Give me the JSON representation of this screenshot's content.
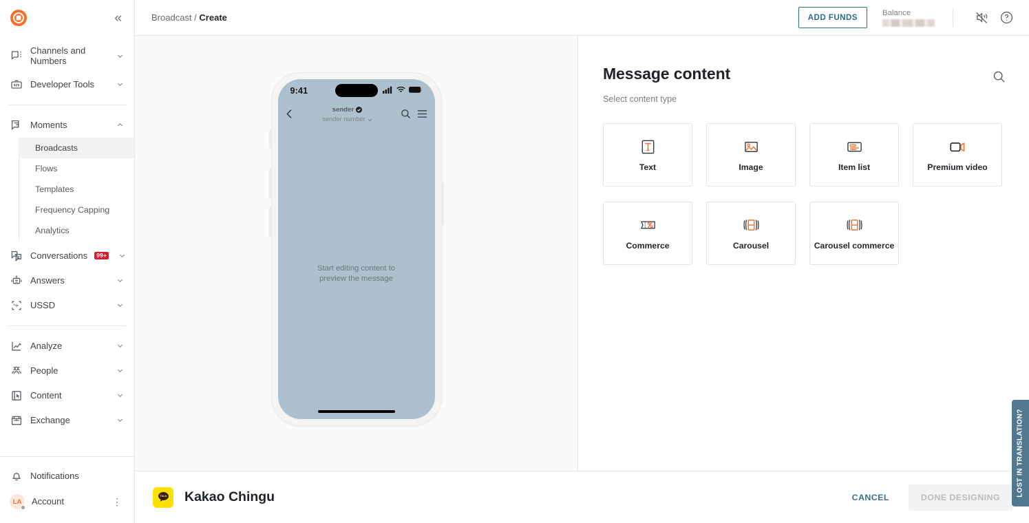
{
  "sidebar": {
    "brand_icon": "bullseye-logo-icon",
    "collapse_icon": "chevron-double-left-icon",
    "groups": [
      {
        "items": [
          {
            "label": "Channels and Numbers",
            "icon": "chat-dots-icon",
            "chevron": "chevron-down-icon"
          },
          {
            "label": "Developer Tools",
            "icon": "code-toolbox-icon",
            "chevron": "chevron-down-icon"
          }
        ]
      },
      {
        "items": [
          {
            "label": "Moments",
            "icon": "moments-layers-icon",
            "chevron": "chevron-up-icon",
            "expanded": true
          }
        ],
        "submenu": [
          {
            "label": "Broadcasts",
            "active": true
          },
          {
            "label": "Flows",
            "active": false
          },
          {
            "label": "Templates",
            "active": false
          },
          {
            "label": "Frequency Capping",
            "active": false
          },
          {
            "label": "Analytics",
            "active": false
          }
        ]
      },
      {
        "items": [
          {
            "label": "Conversations",
            "icon": "conversations-icon",
            "badge": "99+",
            "chevron": "chevron-down-icon"
          },
          {
            "label": "Answers",
            "icon": "robot-icon",
            "chevron": "chevron-down-icon"
          },
          {
            "label": "USSD",
            "icon": "ussd-star-hash-icon",
            "chevron": "chevron-down-icon"
          }
        ]
      },
      {
        "items": [
          {
            "label": "Analyze",
            "icon": "line-chart-icon",
            "chevron": "chevron-down-icon"
          },
          {
            "label": "People",
            "icon": "people-icon",
            "chevron": "chevron-down-icon"
          },
          {
            "label": "Content",
            "icon": "content-cursor-icon",
            "chevron": "chevron-down-icon"
          },
          {
            "label": "Exchange",
            "icon": "storefront-icon",
            "chevron": "chevron-down-icon"
          }
        ]
      }
    ],
    "bottom": {
      "notifications_label": "Notifications",
      "notifications_icon": "bell-icon",
      "account_label": "Account",
      "account_initials": "LA",
      "account_menu_icon": "kebab-menu-icon"
    }
  },
  "topbar": {
    "breadcrumb_parent": "Broadcast",
    "breadcrumb_separator": "/",
    "breadcrumb_current": "Create",
    "add_funds_label": "ADD FUNDS",
    "balance_label": "Balance",
    "balance_value": "",
    "mute_icon": "speaker-muted-icon",
    "help_icon": "help-circle-icon"
  },
  "preview": {
    "status_time": "9:41",
    "signal_icon": "cellular-signal-icon",
    "wifi_icon": "wifi-icon",
    "battery_icon": "battery-icon",
    "back_icon": "chevron-left-icon",
    "sender_name": "sender",
    "verified_icon": "verified-badge-icon",
    "sender_number": "sender number",
    "sender_dropdown_icon": "caret-down-icon",
    "search_icon": "search-icon",
    "menu_icon": "hamburger-menu-icon",
    "placeholder_line1": "Start editing content to",
    "placeholder_line2": "preview the message"
  },
  "content": {
    "title": "Message content",
    "search_icon": "search-icon",
    "subtitle": "Select content type",
    "types": [
      {
        "label": "Text",
        "icon": "text-type-icon"
      },
      {
        "label": "Image",
        "icon": "image-type-icon"
      },
      {
        "label": "Item list",
        "icon": "item-list-type-icon"
      },
      {
        "label": "Premium video",
        "icon": "premium-video-type-icon"
      },
      {
        "label": "Commerce",
        "icon": "commerce-ticket-icon"
      },
      {
        "label": "Carousel",
        "icon": "carousel-icon"
      },
      {
        "label": "Carousel commerce",
        "icon": "carousel-commerce-icon"
      }
    ]
  },
  "footer": {
    "channel_logo_icon": "kakaotalk-logo-icon",
    "channel_logo_text": "TALK",
    "channel_name": "Kakao Chingu",
    "cancel_label": "CANCEL",
    "done_label": "DONE DESIGNING"
  },
  "side_tab": {
    "label": "LOST IN TRANSLATION?"
  },
  "colors": {
    "accent_orange": "#f2702a",
    "link_blue": "#2d6b8f",
    "badge_red": "#e0162b",
    "phone_screen": "#adc0cd",
    "side_tab": "#50788f",
    "kakao_yellow": "#fae100"
  }
}
